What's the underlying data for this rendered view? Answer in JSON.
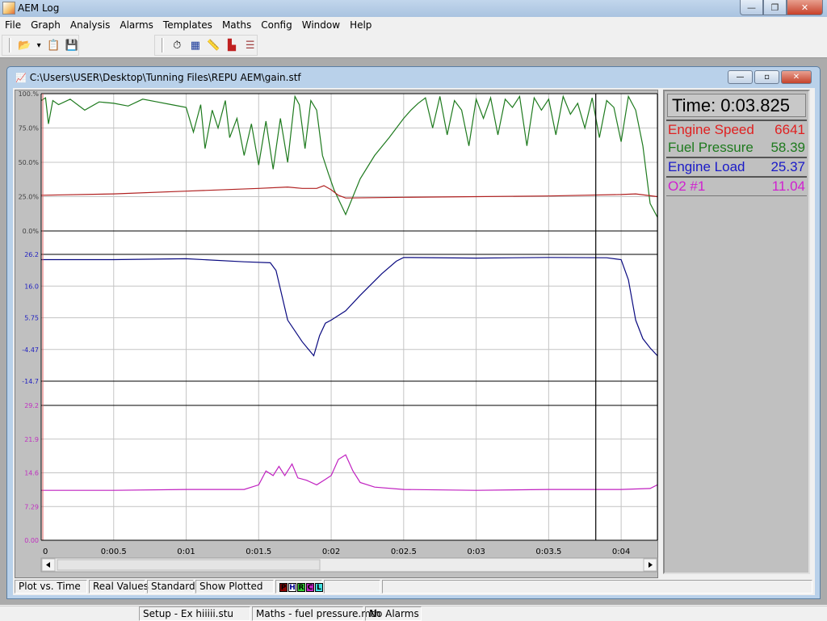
{
  "app": {
    "title": "AEM Log",
    "window_controls": {
      "minimize": "—",
      "restore": "❐",
      "close": "✕"
    }
  },
  "menu": [
    "File",
    "Graph",
    "Analysis",
    "Alarms",
    "Templates",
    "Maths",
    "Config",
    "Window",
    "Help"
  ],
  "toolbar": {
    "left": [
      {
        "name": "open-folder-icon",
        "glyph": "📂"
      },
      {
        "name": "dropdown-arrow-icon",
        "glyph": "▾"
      },
      {
        "name": "notepad-icon",
        "glyph": "📋"
      },
      {
        "name": "save-icon",
        "glyph": "💾"
      }
    ],
    "right": [
      {
        "name": "stopwatch-icon",
        "glyph": "⏱"
      },
      {
        "name": "table-icon",
        "glyph": "▦"
      },
      {
        "name": "ruler-icon",
        "glyph": "📏"
      },
      {
        "name": "bar-chart-icon",
        "glyph": "▙"
      },
      {
        "name": "grid-lines-icon",
        "glyph": "☰"
      }
    ]
  },
  "document": {
    "path": "C:\\Users\\USER\\Desktop\\Tunning Files\\REPU AEM\\gain.stf",
    "controls": {
      "minimize": "—",
      "restore": "▫",
      "close": "✕"
    }
  },
  "readout": {
    "time": "Time: 0:03.825",
    "channels": [
      {
        "label": "Engine Speed",
        "value": "6641",
        "color": "#e02020"
      },
      {
        "label": "Fuel Pressure",
        "value": "58.39",
        "color": "#1e7a1e"
      },
      {
        "label": "Engine Load",
        "value": "25.37",
        "color": "#1a1ac8"
      },
      {
        "label": "O2 #1",
        "value": "11.04",
        "color": "#d020d0"
      }
    ]
  },
  "status_plot": {
    "cells": [
      "Plot vs. Time",
      "Real Values",
      "Standard",
      "Show Plotted"
    ],
    "indicators": [
      {
        "letter": "P",
        "bg": "#8b0000",
        "fg": "#000"
      },
      {
        "letter": "H",
        "bg": "#ffffff",
        "fg": "#00008b"
      },
      {
        "letter": "R",
        "bg": "#32cd32",
        "fg": "#000"
      },
      {
        "letter": "C",
        "bg": "#c020c0",
        "fg": "#000"
      },
      {
        "letter": "L",
        "bg": "#40e0e0",
        "fg": "#000"
      }
    ]
  },
  "status_main": {
    "cells": [
      "Setup - Ex hiiiii.stu",
      "Maths - fuel pressure.mth",
      "No Alarms"
    ]
  },
  "chart_data": {
    "type": "line",
    "xlabel": "Time",
    "x_range": [
      0,
      4.25
    ],
    "x_ticks": [
      "0",
      "0:00.5",
      "0:01",
      "0:01.5",
      "0:02",
      "0:02.5",
      "0:03",
      "0:03.5",
      "0:04"
    ],
    "cursor_time": 3.825,
    "panels": [
      {
        "name": "panel-1",
        "y_ticks": [
          "100.%",
          "75.0%",
          "50.0%",
          "25.0%",
          "0.0%"
        ],
        "y_range": [
          0,
          100
        ],
        "tick_color": "#404040",
        "series": [
          {
            "name": "Fuel Pressure",
            "color": "#1e7a1e",
            "x": [
              0,
              0.03,
              0.05,
              0.08,
              0.12,
              0.2,
              0.3,
              0.4,
              0.5,
              0.6,
              0.7,
              0.8,
              0.9,
              1.0,
              1.05,
              1.1,
              1.13,
              1.18,
              1.22,
              1.27,
              1.3,
              1.35,
              1.4,
              1.45,
              1.5,
              1.55,
              1.6,
              1.65,
              1.7,
              1.75,
              1.78,
              1.82,
              1.86,
              1.9,
              1.94,
              1.98,
              2.02,
              2.1,
              2.2,
              2.3,
              2.4,
              2.5,
              2.55,
              2.6,
              2.65,
              2.7,
              2.75,
              2.8,
              2.85,
              2.9,
              2.95,
              3.0,
              3.05,
              3.1,
              3.15,
              3.2,
              3.25,
              3.3,
              3.35,
              3.4,
              3.45,
              3.5,
              3.55,
              3.6,
              3.65,
              3.7,
              3.75,
              3.8,
              3.85,
              3.9,
              3.95,
              4.0,
              4.05,
              4.1,
              4.15,
              4.2,
              4.25
            ],
            "values": [
              95,
              97,
              78,
              95,
              92,
              96,
              88,
              94,
              93,
              91,
              96,
              94,
              92,
              90,
              72,
              92,
              60,
              88,
              75,
              95,
              68,
              82,
              55,
              78,
              48,
              80,
              45,
              82,
              50,
              98,
              92,
              60,
              95,
              88,
              55,
              42,
              30,
              12,
              38,
              55,
              68,
              82,
              88,
              93,
              97,
              75,
              98,
              70,
              95,
              88,
              62,
              96,
              82,
              97,
              70,
              96,
              90,
              98,
              62,
              97,
              88,
              96,
              70,
              98,
              85,
              93,
              75,
              97,
              68,
              95,
              90,
              65,
              98,
              88,
              62,
              20,
              10
            ]
          },
          {
            "name": "Engine Speed",
            "color": "#b02020",
            "x": [
              0,
              0.5,
              1.0,
              1.5,
              1.7,
              1.8,
              1.9,
              1.95,
              2.0,
              2.05,
              2.1,
              2.5,
              3.0,
              3.5,
              4.0,
              4.1,
              4.25
            ],
            "values": [
              26,
              27,
              29,
              31,
              32,
              31,
              31,
              33,
              30,
              26,
              24,
              24.5,
              25,
              25.5,
              26.5,
              27,
              25
            ]
          }
        ]
      },
      {
        "name": "panel-2",
        "y_ticks": [
          "26.2",
          "16.0",
          "5.75",
          "-4.47",
          "-14.7"
        ],
        "y_range": [
          -14.7,
          26.2
        ],
        "tick_color": "#2020c0",
        "series": [
          {
            "name": "Engine Load",
            "color": "#0a0a80",
            "x": [
              0,
              0.5,
              1.0,
              1.4,
              1.58,
              1.62,
              1.7,
              1.8,
              1.88,
              1.92,
              1.96,
              2.0,
              2.1,
              2.2,
              2.35,
              2.45,
              2.5,
              3.0,
              3.5,
              3.9,
              4.0,
              4.05,
              4.1,
              4.15,
              4.2,
              4.25
            ],
            "values": [
              24.5,
              24.5,
              24.8,
              23.8,
              23.5,
              21,
              5,
              -2,
              -6.5,
              0,
              4,
              5,
              8,
              13,
              20,
              24,
              25.2,
              25.0,
              25.2,
              25.1,
              24.5,
              18,
              5,
              -1,
              -4,
              -6.5
            ]
          }
        ]
      },
      {
        "name": "panel-3",
        "y_ticks": [
          "29.2",
          "21.9",
          "14.6",
          "7.29",
          "0.00"
        ],
        "y_range": [
          0,
          29.2
        ],
        "tick_color": "#c030c0",
        "series": [
          {
            "name": "O2 #1",
            "color": "#c020c0",
            "x": [
              0,
              0.5,
              1.0,
              1.4,
              1.5,
              1.55,
              1.6,
              1.64,
              1.68,
              1.73,
              1.77,
              1.83,
              1.9,
              1.95,
              2.0,
              2.05,
              2.1,
              2.15,
              2.2,
              2.3,
              2.5,
              3.0,
              3.5,
              4.0,
              4.2,
              4.25
            ],
            "values": [
              10.8,
              10.8,
              11,
              11,
              12,
              15,
              14,
              16,
              14,
              16.5,
              13.5,
              13,
              12,
              13,
              14,
              17.5,
              18.5,
              15,
              12.5,
              11.5,
              11,
              10.8,
              11,
              11,
              11.2,
              12
            ]
          }
        ]
      }
    ]
  }
}
